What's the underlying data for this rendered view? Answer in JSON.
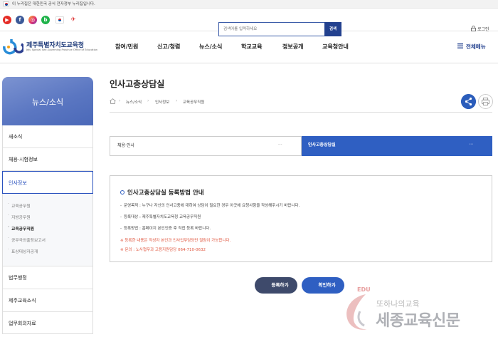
{
  "gov_banner": {
    "text": "이 누리집은 대한민국 공식 전자정부 누리집입니다."
  },
  "social": {
    "items": [
      "youtube-icon",
      "facebook-icon",
      "instagram-icon",
      "blog-icon",
      "korea-flag-icon",
      "more-icon"
    ]
  },
  "search": {
    "placeholder": "검색어를 입력하세요",
    "button_label": "검색"
  },
  "login": {
    "label": "로그인"
  },
  "logo": {
    "name": "제주특별자치도교육청",
    "subtitle": "Jeju Special Self-Governing Province Office of Education"
  },
  "gnb": {
    "items": [
      "참여/민원",
      "신고/청렴",
      "뉴스/소식",
      "학교교육",
      "정보공개",
      "교육청안내"
    ],
    "all_menu": "전체메뉴"
  },
  "sidebar": {
    "title": "뉴스/소식",
    "items": [
      "새소식",
      "채용·시험정보",
      "인사정보",
      "법무행정",
      "제주교육소식",
      "업무회의자료"
    ],
    "sub_items": [
      "교육공무원",
      "지방공무원",
      "교육공무직원",
      "공무국외출장보고서",
      "표상대상자공개"
    ],
    "active_item": "인사정보",
    "active_sub_item": "교육공무직원"
  },
  "page": {
    "title": "인사고충상담실",
    "breadcrumb": [
      "뉴스/소식",
      "인사정보",
      "교육공무직원"
    ]
  },
  "selectors": {
    "left_label": "채용·인사",
    "left_indicator": "···",
    "right_label": "인사고충상담실",
    "right_indicator": "⋯"
  },
  "info": {
    "title": "인사고충상담실 등록방법 안내",
    "lines": [
      "운영목적 : 누구나 자신의 인사고충에 대하여 상담이 필요한 경우 아곳에 요청사항을 작성해주시기 바랍니다.",
      "등록대상 : 제주특별자치도교육청 교육공무직원",
      "등록방법 : 홈페이지 본인인증 후 직접 등록 바랍니다."
    ],
    "notes": [
      "※ 등록한 내용은 작성자 본인과 인사업무담당만 열람이 가능합니다.",
      "※ 문의 : 노사협무과 고용지원담당 064-710-0632"
    ]
  },
  "buttons": {
    "register": "등록하기",
    "check": "확인하기",
    "arrow": "→"
  },
  "watermark": {
    "edu": "EDU",
    "sub": "또하나의교육",
    "main": "세종교육신문"
  },
  "colors": {
    "primary": "#2f5fc2",
    "navy": "#23418f",
    "sidebar_gradient": "#5b77c2",
    "note_red": "#e0553e"
  }
}
